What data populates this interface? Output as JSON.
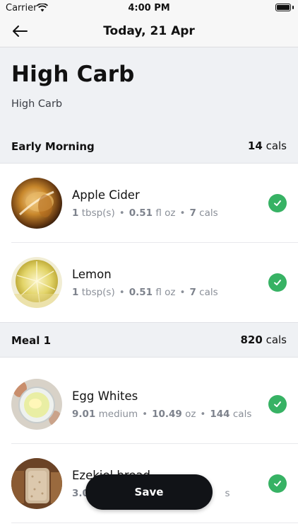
{
  "status_bar": {
    "carrier": "Carrier",
    "time": "4:00 PM"
  },
  "nav": {
    "title": "Today, 21 Apr"
  },
  "plan": {
    "title": "High Carb",
    "subtitle": "High Carb"
  },
  "sections": [
    {
      "name": "Early Morning",
      "cals_value": "14",
      "cals_unit": "cals",
      "items": [
        {
          "name": "Apple Cider",
          "qty": "1",
          "qty_unit": "tbsp(s)",
          "weight": "0.51",
          "weight_unit": "fl oz",
          "cals": "7",
          "cals_unit": "cals",
          "image": "apple-cider-photo"
        },
        {
          "name": "Lemon",
          "qty": "1",
          "qty_unit": "tbsp(s)",
          "weight": "0.51",
          "weight_unit": "fl oz",
          "cals": "7",
          "cals_unit": "cals",
          "image": "lemon-photo"
        }
      ]
    },
    {
      "name": "Meal 1",
      "cals_value": "820",
      "cals_unit": "cals",
      "items": [
        {
          "name": "Egg Whites",
          "qty": "9.01",
          "qty_unit": "medium",
          "weight": "10.49",
          "weight_unit": "oz",
          "cals": "144",
          "cals_unit": "cals",
          "image": "egg-whites-photo"
        },
        {
          "name": "Ezekiel bread",
          "qty": "3.0",
          "qty_unit": "",
          "weight": "",
          "weight_unit": "",
          "cals": "",
          "cals_unit": "s",
          "image": "ezekiel-bread-photo"
        }
      ]
    }
  ],
  "save_button": {
    "label": "Save"
  },
  "colors": {
    "accent_green": "#37b264",
    "header_bg": "#eff1f4",
    "button_dark": "#111317"
  }
}
